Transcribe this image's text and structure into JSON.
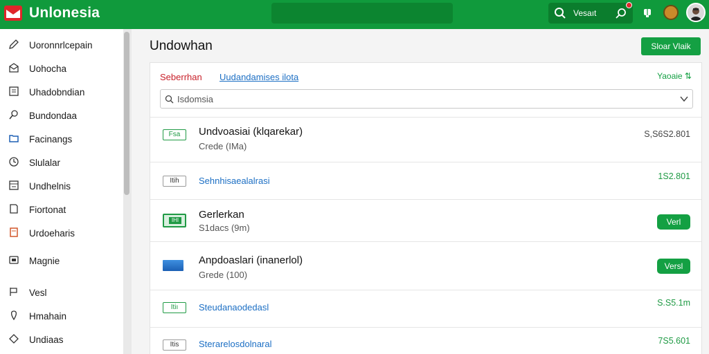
{
  "app": {
    "title": "Unlonesia"
  },
  "search": {
    "label": "Vesaıt"
  },
  "sidebar": {
    "items": [
      {
        "label": "Uoronnrlcepain",
        "icon": "pencil-icon"
      },
      {
        "label": "Uohocha",
        "icon": "mail-icon"
      },
      {
        "label": "Uhadobndian",
        "icon": "document-icon"
      },
      {
        "label": "Bundondaa",
        "icon": "search-person-icon"
      },
      {
        "label": "Facinangs",
        "icon": "folder-icon"
      },
      {
        "label": "Slulalar",
        "icon": "clock-icon"
      },
      {
        "label": "Undhelnis",
        "icon": "list-icon"
      },
      {
        "label": "Fiortonat",
        "icon": "page-icon"
      },
      {
        "label": "Urdoeharis",
        "icon": "orange-document-icon"
      },
      {
        "label": "Magnie",
        "icon": "screen-icon"
      },
      {
        "label": "Vesl",
        "icon": "flag-icon"
      },
      {
        "label": "Hmahain",
        "icon": "location-icon"
      },
      {
        "label": "Undiaas",
        "icon": "tag-icon"
      }
    ]
  },
  "main": {
    "title": "Undowhan",
    "primary_button": "Sloar Vlaik",
    "tab_active": "Seberrhan",
    "tab_link": "Uudandamises ilota",
    "status": "Yaoaie ⇅",
    "filter_value": "Isdomsia"
  },
  "rows": [
    {
      "badge": "Fsa",
      "title": "Undvoasiai (klqarekar)",
      "subtitle": "Crede (IMa)",
      "value": "S,S6S2.801"
    },
    {
      "badge": "Itih",
      "link": "Sehnhisaealalrasi",
      "value": "1S2.801"
    },
    {
      "badge": "IHI",
      "title": "Gerlerkan",
      "subtitle": "S1dacs (9m)",
      "button": "Verl"
    },
    {
      "title": "Anpdoaslari (inanerlol)",
      "subtitle": "Grede (100)",
      "button": "Versl"
    },
    {
      "badge": "Itiı",
      "link": "Steudanaodedasl",
      "value": "S.S5.1m"
    },
    {
      "badge": "Itis",
      "link": "Sterarelosdolnaral",
      "value": "7S5.601"
    }
  ],
  "colors": {
    "brand": "#109a3c",
    "button": "#14a043",
    "link": "#1c6fc4",
    "danger": "#c8202a"
  }
}
